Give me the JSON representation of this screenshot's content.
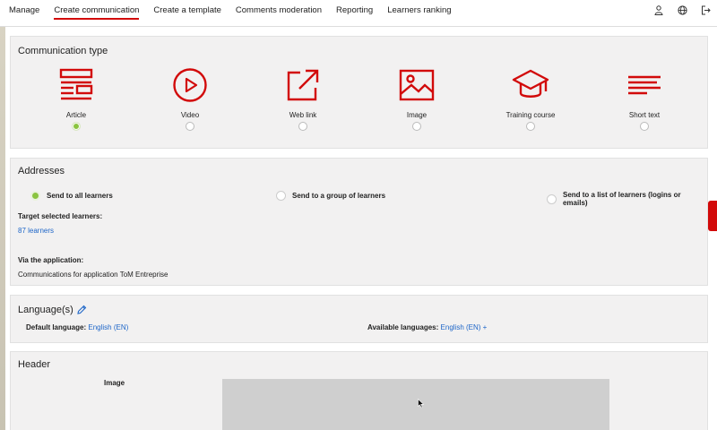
{
  "nav": {
    "items": [
      "Manage",
      "Create communication",
      "Create a template",
      "Comments moderation",
      "Reporting",
      "Learners ranking"
    ],
    "active_index": 1,
    "icons": [
      "user-icon",
      "globe-icon",
      "logout-icon"
    ]
  },
  "comm_type": {
    "title": "Communication type",
    "types": [
      {
        "label": "Article",
        "icon": "article-icon",
        "selected": true
      },
      {
        "label": "Video",
        "icon": "video-icon",
        "selected": false
      },
      {
        "label": "Web link",
        "icon": "web-link-icon",
        "selected": false
      },
      {
        "label": "Image",
        "icon": "image-icon",
        "selected": false
      },
      {
        "label": "Training course",
        "icon": "training-course-icon",
        "selected": false
      },
      {
        "label": "Short text",
        "icon": "short-text-icon",
        "selected": false
      }
    ]
  },
  "addresses": {
    "title": "Addresses",
    "options": [
      {
        "label": "Send to all learners",
        "selected": true
      },
      {
        "label": "Send to a group of learners",
        "selected": false
      },
      {
        "label": "Send to a list of learners (logins or emails)",
        "selected": false
      }
    ],
    "target_label": "Target selected learners:",
    "target_value": "87 learners",
    "via_label": "Via the application:",
    "via_value": "Communications for application ToM Entreprise"
  },
  "languages": {
    "title": "Language(s)",
    "default_label": "Default language:",
    "default_value": "English (EN)",
    "available_label": "Available languages:",
    "available_value": "English (EN) +"
  },
  "header": {
    "title": "Header",
    "image_label": "Image"
  },
  "colors": {
    "accent": "#d20a0a",
    "selected_radio": "#8ac43f",
    "link": "#1e66c8"
  }
}
